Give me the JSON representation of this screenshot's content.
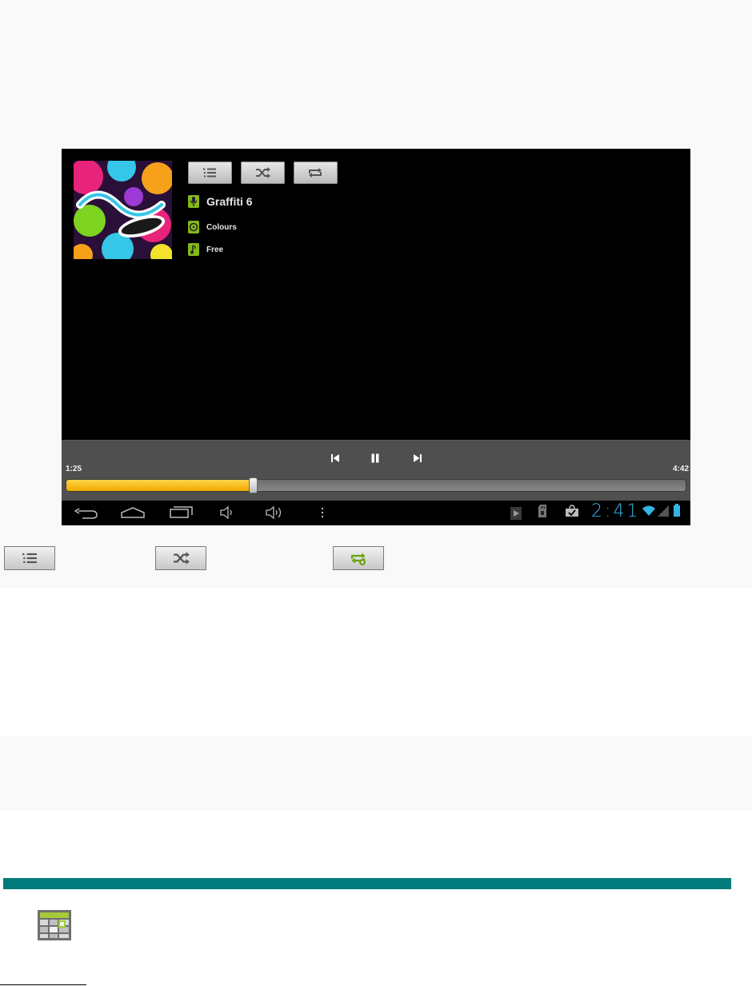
{
  "player": {
    "track": {
      "title": "Graffiti 6",
      "album": "Colours",
      "song": "Free"
    },
    "time": {
      "elapsed": "1:25",
      "total": "4:42",
      "progress": 0.301
    },
    "top_buttons": [
      "playlist-icon",
      "shuffle-icon",
      "repeat-icon"
    ],
    "transport": [
      "previous-icon",
      "pause-icon",
      "next-icon"
    ],
    "status_bar": {
      "clock": "2:41",
      "nav_icons": [
        "back-icon",
        "home-icon",
        "recent-apps-icon",
        "volume-down-icon",
        "volume-up-icon",
        "menu-icon"
      ],
      "status_icons": [
        "play-store-icon",
        "sd-card-icon",
        "shopping-bag-icon",
        "wifi-icon",
        "signal-icon",
        "battery-icon"
      ]
    }
  },
  "legend_buttons": [
    "playlist-icon",
    "shuffle-icon",
    "repeat-all-icon"
  ],
  "colors": {
    "accent_green": "#86b817",
    "progress_yellow": "#f7b500",
    "clock_blue": "#33b5e5",
    "section_teal": "#007b7b"
  }
}
